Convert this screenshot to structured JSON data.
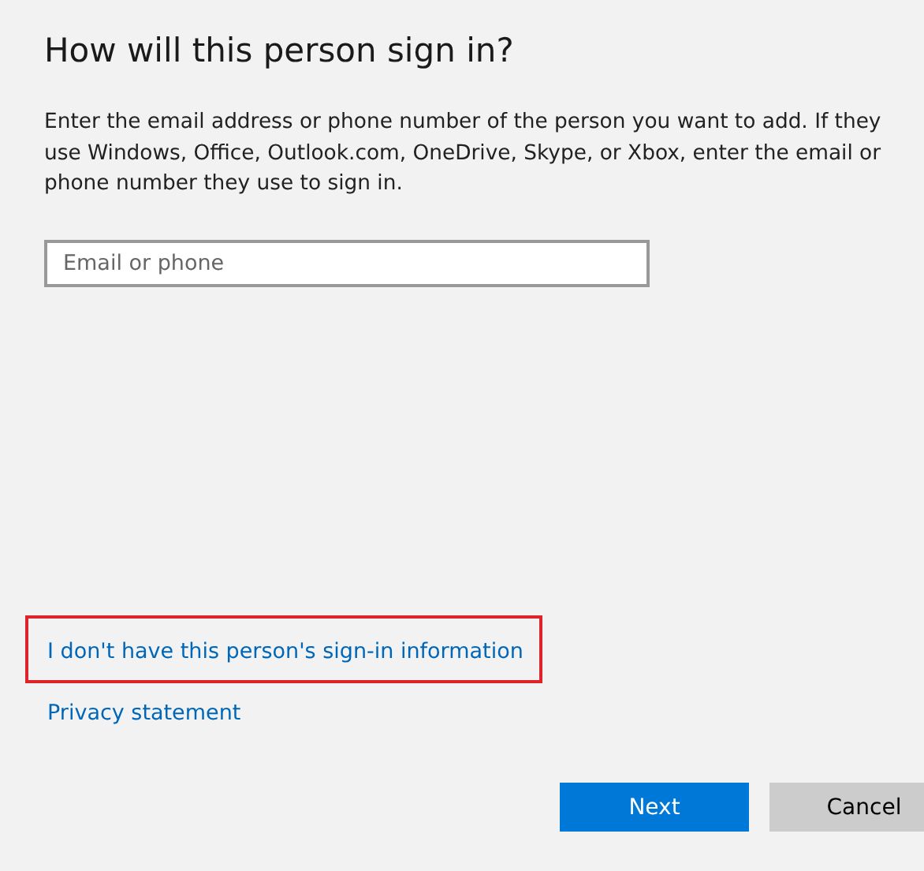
{
  "title": "How will this person sign in?",
  "description": "Enter the email address or phone number of the person you want to add. If they use Windows, Office, Outlook.com, OneDrive, Skype, or Xbox, enter the email or phone number they use to sign in.",
  "email_field": {
    "placeholder": "Email or phone"
  },
  "links": [
    {
      "label": "I don't have this person's sign-in information",
      "highlighted": true
    },
    {
      "label": "Privacy statement",
      "highlighted": false
    }
  ],
  "buttons": [
    {
      "label": "Next",
      "kind": "primary"
    },
    {
      "label": "Cancel",
      "kind": "secondary"
    }
  ]
}
